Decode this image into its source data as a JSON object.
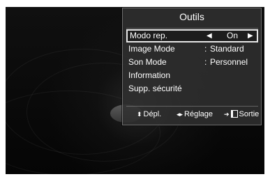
{
  "osd": {
    "title": "Outils",
    "items": [
      {
        "label": "Modo rep.",
        "arrow_left": "◀",
        "value": "On",
        "arrow_right": "▶",
        "selected": true
      },
      {
        "label": "Image Mode",
        "colon": ":",
        "value": "Standard"
      },
      {
        "label": "Son Mode",
        "colon": ":",
        "value": "Personnel"
      },
      {
        "label": "Information"
      },
      {
        "label": "Supp. sécurité"
      }
    ],
    "footer": {
      "move_icon": "updown-arrow-icon",
      "move_label": "Dépl.",
      "adjust_icon": "leftright-arrow-icon",
      "adjust_label": "Réglage",
      "exit_icon": "exit-icon",
      "exit_label": "Sortie"
    }
  },
  "colors": {
    "panel_bg": "#303030",
    "text": "#ffffff",
    "highlight_border": "#e6e6e6"
  }
}
